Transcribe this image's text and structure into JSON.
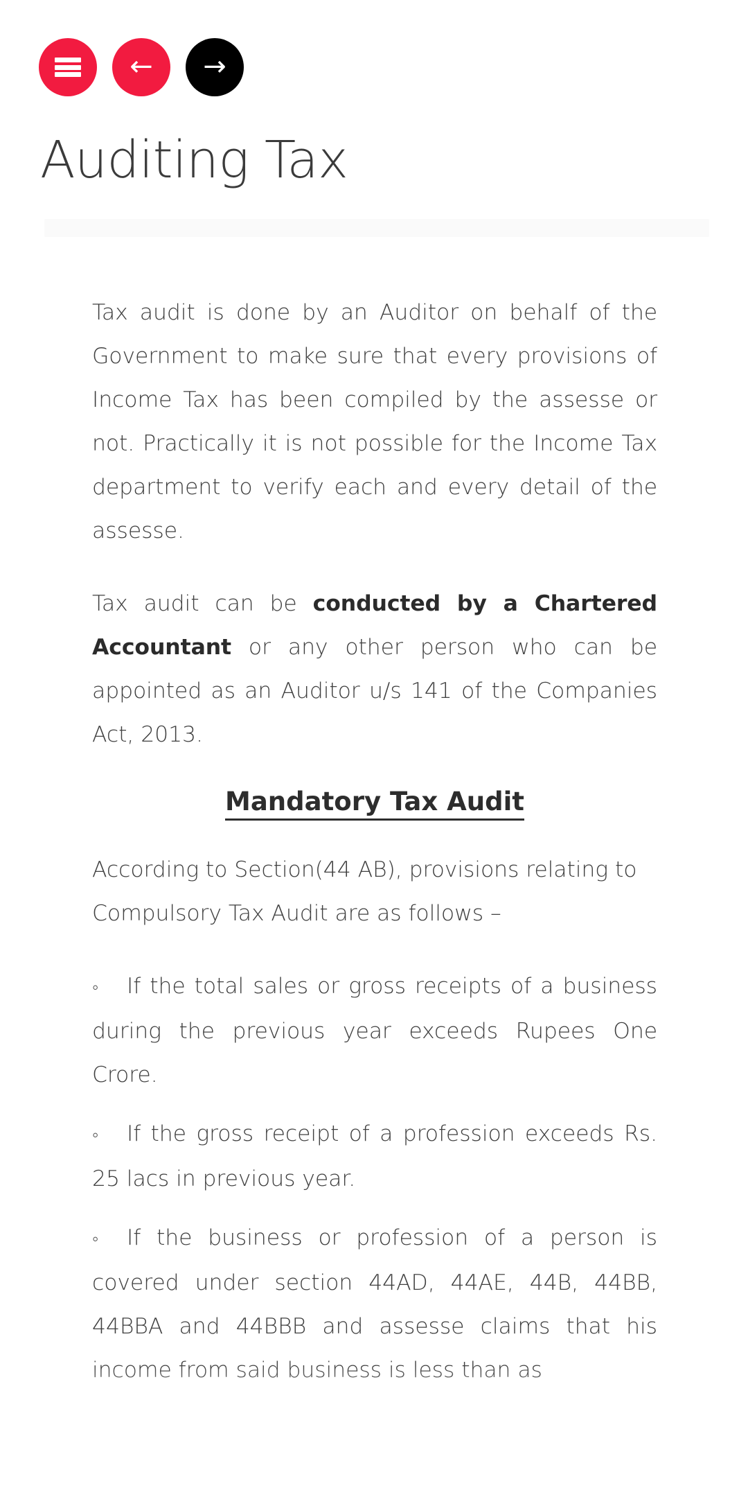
{
  "toolbar": {
    "menu_button": {
      "icon": "hamburger-menu-icon",
      "label": "Menu",
      "color": "#F21B40"
    },
    "back_button": {
      "icon": "arrow-left-icon",
      "glyph": "←",
      "label": "Previous",
      "color": "#F21B40"
    },
    "forward_button": {
      "icon": "arrow-right-icon",
      "glyph": "→",
      "label": "Next",
      "color": "#000000"
    }
  },
  "header": {
    "title": "Auditing Tax"
  },
  "progress": {
    "value": 0
  },
  "article": {
    "paragraph_1": "Tax audit is done by an Auditor on behalf of the Government to make sure that every provisions of Income Tax has been compiled by the assesse or not. Practically it is not possible for the Income Tax department to verify each and every detail of the assesse.",
    "paragraph_2_lead": "Tax audit can be ",
    "paragraph_2_bold": "conducted by a Chartered Accountant",
    "paragraph_2_tail": " or any other person who can be appointed as an Auditor u/s 141 of the Companies Act, 2013.",
    "section_heading": "Mandatory Tax Audit",
    "paragraph_3": "According to Section(44 AB), provisions relating to Compulsory Tax Audit are as follows –",
    "bullets": [
      {
        "marker": "◦",
        "text": "If the total sales or gross receipts of a business during the previous year exceeds Rupees One Crore."
      },
      {
        "marker": "◦",
        "text": "If the gross receipt of a profession exceeds Rs. 25 lacs in previous year."
      },
      {
        "marker": "◦",
        "text": "If the business or profession of a person is covered under section 44AD, 44AE, 44B, 44BB, 44BBA and 44BBB and assesse claims that his income from said business is less than as"
      }
    ]
  }
}
